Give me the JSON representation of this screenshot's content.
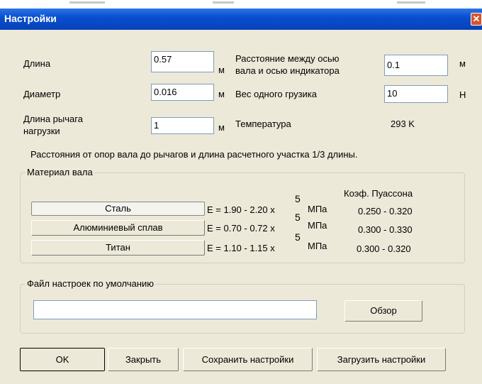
{
  "window": {
    "title": "Настройки",
    "close_glyph": "✕"
  },
  "fields": {
    "length": {
      "label": "Длина",
      "value": "0.57",
      "unit": "м"
    },
    "diameter": {
      "label": "Диаметр",
      "value": "0.016",
      "unit": "м"
    },
    "lever_length": {
      "label_line1": "Длина рычага",
      "label_line2": "нагрузки",
      "value": "1",
      "unit": "м"
    },
    "axis_distance": {
      "label_line1": "Расстояние между осью",
      "label_line2": "вала и осью индикатора",
      "value": "0.1",
      "unit": "м"
    },
    "weight": {
      "label": "Вес одного грузика",
      "value": "10",
      "unit": "Н"
    },
    "temperature": {
      "label": "Температура",
      "value": "293 K"
    }
  },
  "note": "Расстояния от опор вала до рычагов и длина расчетного участка 1/3 длины.",
  "material_group": {
    "legend": "Материал вала",
    "poisson_header": "Коэф. Пуассона",
    "materials": [
      {
        "name": "Сталь",
        "modulus": "E = 1.90 - 2.20 x",
        "exponent": "5",
        "unit": "МПа",
        "poisson": "0.250 - 0.320"
      },
      {
        "name": "Алюминиевый сплав",
        "modulus": "E = 0.70 - 0.72 x",
        "exponent": "5",
        "unit": "МПа",
        "poisson": "0.300 - 0.330"
      },
      {
        "name": "Титан",
        "modulus": "E = 1.10 - 1.15 x",
        "exponent": "5",
        "unit": "МПа",
        "poisson": "0.300 - 0.320"
      }
    ]
  },
  "default_file_group": {
    "legend": "Файл настроек по умолчанию",
    "path_value": "",
    "browse_label": "Обзор"
  },
  "buttons": {
    "ok": "OK",
    "close": "Закрыть",
    "save": "Сохранить настройки",
    "load": "Загрузить настройки"
  }
}
